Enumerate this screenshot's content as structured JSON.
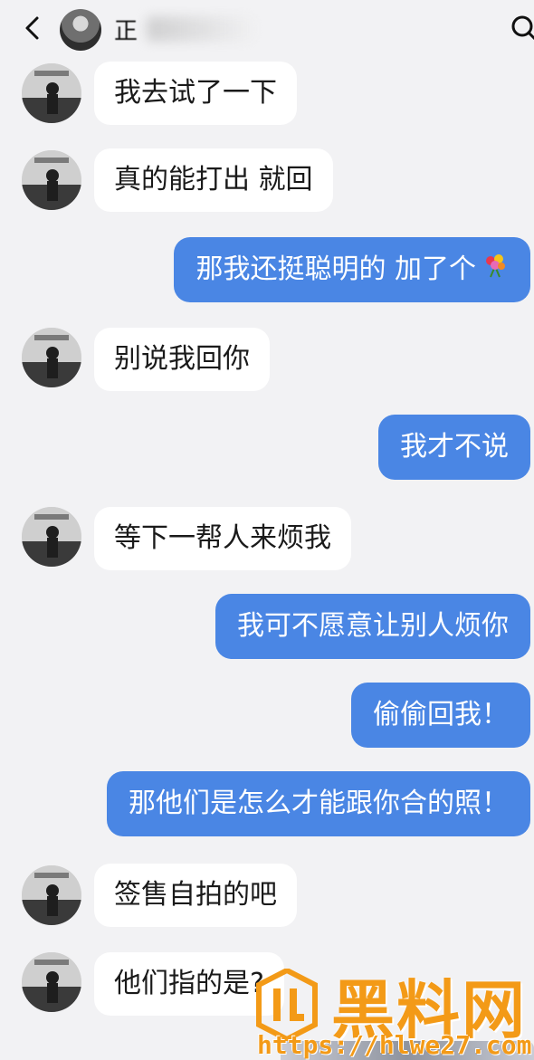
{
  "header": {
    "title": "正",
    "back_icon": "chevron-left-icon",
    "search_icon": "search-icon"
  },
  "messages": [
    {
      "from": "them",
      "text": "我去试了一下"
    },
    {
      "from": "them",
      "text": "真的能打出 就回"
    },
    {
      "from": "me",
      "text": "那我还挺聪明的 加了个",
      "emoji": "flower-bouquet-icon"
    },
    {
      "from": "them",
      "text": "别说我回你"
    },
    {
      "from": "me",
      "text": "我才不说"
    },
    {
      "from": "them",
      "text": "等下一帮人来烦我"
    },
    {
      "from": "me",
      "text": "我可不愿意让别人烦你"
    },
    {
      "from": "me",
      "text": "偷偷回我！"
    },
    {
      "from": "me",
      "text": "那他们是怎么才能跟你合的照！"
    },
    {
      "from": "them",
      "text": "签售自拍的吧"
    },
    {
      "from": "them",
      "text": "他们指的是?"
    }
  ],
  "watermark": {
    "logo_text": "黑料网",
    "url": "https://hlwe27.com"
  },
  "colors": {
    "background": "#f2f2f4",
    "outgoing_bubble": "#4a86e4",
    "incoming_bubble": "#ffffff",
    "watermark": "#f39a17"
  }
}
